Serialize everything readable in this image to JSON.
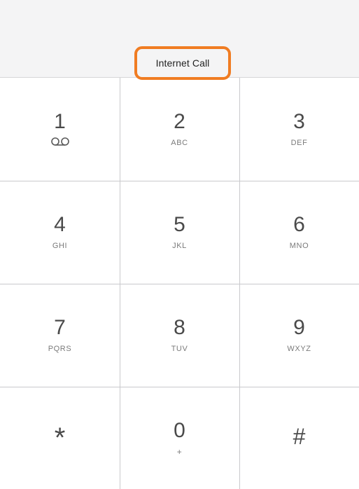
{
  "header": {
    "mode_label": "Internet Call",
    "accent_color": "#f07c22"
  },
  "keypad": {
    "keys": [
      {
        "digit": "1",
        "letters": "",
        "icon": "voicemail-icon"
      },
      {
        "digit": "2",
        "letters": "ABC"
      },
      {
        "digit": "3",
        "letters": "DEF"
      },
      {
        "digit": "4",
        "letters": "GHI"
      },
      {
        "digit": "5",
        "letters": "JKL"
      },
      {
        "digit": "6",
        "letters": "MNO"
      },
      {
        "digit": "7",
        "letters": "PQRS"
      },
      {
        "digit": "8",
        "letters": "TUV"
      },
      {
        "digit": "9",
        "letters": "WXYZ"
      },
      {
        "digit": "*",
        "letters": ""
      },
      {
        "digit": "0",
        "letters": "+"
      },
      {
        "digit": "#",
        "letters": ""
      }
    ]
  }
}
